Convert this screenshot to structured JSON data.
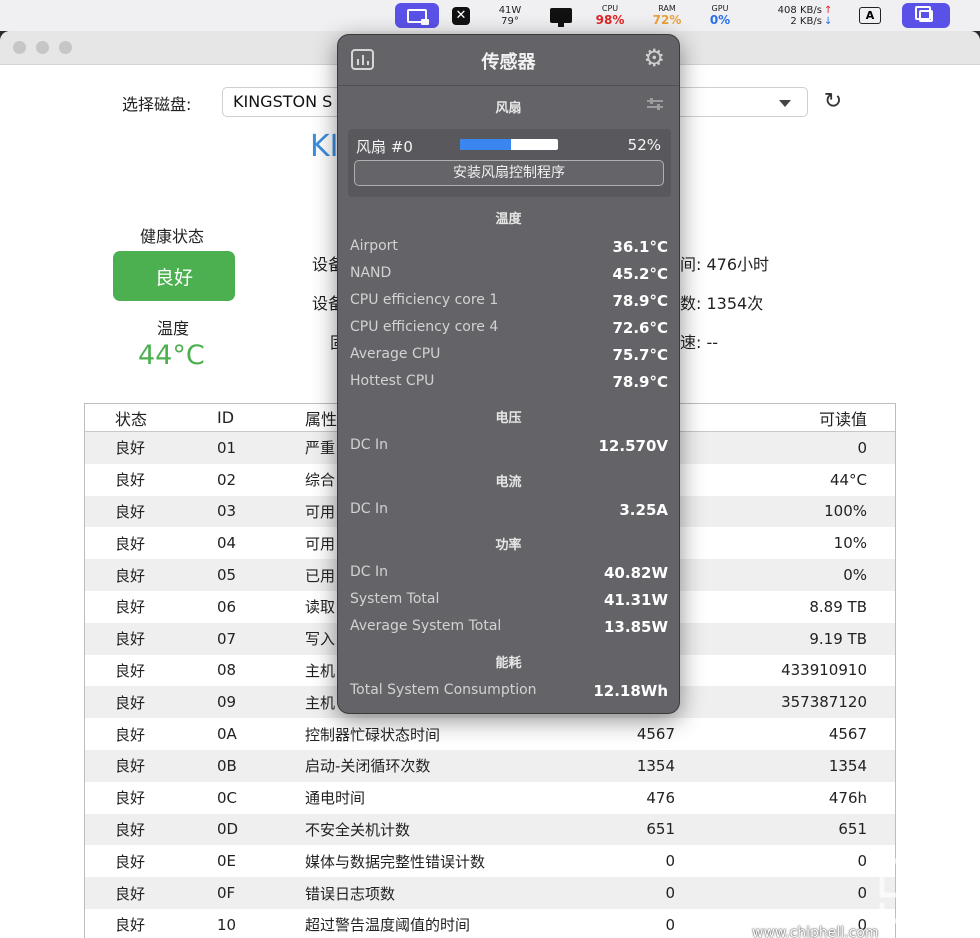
{
  "menubar": {
    "power_watts": "41W",
    "power_temp": "79°",
    "cpu": {
      "label": "CPU",
      "value": "98%",
      "color": "#e02424"
    },
    "ram": {
      "label": "RAM",
      "value": "72%",
      "color": "#e8a23a"
    },
    "gpu": {
      "label": "GPU",
      "value": "0%",
      "color": "#2a6ee8"
    },
    "net_up": "408 KB/s",
    "net_down": "2 KB/s",
    "input_method": "A"
  },
  "window": {
    "disk_label": "选择磁盘:",
    "disk_value": "KINGSTON S",
    "model_title_fragment": "KI",
    "health_label": "健康状态",
    "health_value": "良好",
    "health_color": "#4cb050",
    "temp_label": "温度",
    "temp_value": "44°C",
    "info_left": [
      "设备",
      "设备",
      "固"
    ],
    "info_right": [
      "间:  476小时",
      "数:  1354次",
      "速:  --"
    ]
  },
  "table": {
    "headers": {
      "status": "状态",
      "id": "ID",
      "attribute": "属性",
      "raw": "",
      "readable": "可读值"
    },
    "rows": [
      {
        "status": "良好",
        "id": "01",
        "attribute": "严重",
        "raw": "",
        "readable": "0"
      },
      {
        "status": "良好",
        "id": "02",
        "attribute": "综合",
        "raw": "",
        "readable": "44°C"
      },
      {
        "status": "良好",
        "id": "03",
        "attribute": "可用",
        "raw": "",
        "readable": "100%"
      },
      {
        "status": "良好",
        "id": "04",
        "attribute": "可用",
        "raw": "",
        "readable": "10%"
      },
      {
        "status": "良好",
        "id": "05",
        "attribute": "已用",
        "raw": "",
        "readable": "0%"
      },
      {
        "status": "良好",
        "id": "06",
        "attribute": "读取",
        "raw": "",
        "readable": "8.89 TB"
      },
      {
        "status": "良好",
        "id": "07",
        "attribute": "写入",
        "raw": "",
        "readable": "9.19 TB"
      },
      {
        "status": "良好",
        "id": "08",
        "attribute": "主机",
        "raw": "",
        "readable": "433910910"
      },
      {
        "status": "良好",
        "id": "09",
        "attribute": "主机",
        "raw": "",
        "readable": "357387120"
      },
      {
        "status": "良好",
        "id": "0A",
        "attribute": "控制器忙碌状态时间",
        "raw": "4567",
        "readable": "4567"
      },
      {
        "status": "良好",
        "id": "0B",
        "attribute": "启动-关闭循环次数",
        "raw": "1354",
        "readable": "1354"
      },
      {
        "status": "良好",
        "id": "0C",
        "attribute": "通电时间",
        "raw": "476",
        "readable": "476h"
      },
      {
        "status": "良好",
        "id": "0D",
        "attribute": "不安全关机计数",
        "raw": "651",
        "readable": "651"
      },
      {
        "status": "良好",
        "id": "0E",
        "attribute": "媒体与数据完整性错误计数",
        "raw": "0",
        "readable": "0"
      },
      {
        "status": "良好",
        "id": "0F",
        "attribute": "错误日志项数",
        "raw": "0",
        "readable": "0"
      },
      {
        "status": "良好",
        "id": "10",
        "attribute": "超过警告温度阈值的时间",
        "raw": "0",
        "readable": "0"
      }
    ]
  },
  "panel": {
    "title": "传感器",
    "sections": {
      "fan": "风扇",
      "temperature": "温度",
      "voltage": "电压",
      "current": "电流",
      "power": "功率",
      "energy": "能耗"
    },
    "fan": {
      "name": "风扇 #0",
      "percent_text": "52%",
      "percent": 52,
      "install_button": "安装风扇控制程序"
    },
    "temperature": [
      {
        "name": "Airport",
        "value": "36.1°C"
      },
      {
        "name": "NAND",
        "value": "45.2°C"
      },
      {
        "name": "CPU efficiency core 1",
        "value": "78.9°C"
      },
      {
        "name": "CPU efficiency core 4",
        "value": "72.6°C"
      },
      {
        "name": "Average CPU",
        "value": "75.7°C"
      },
      {
        "name": "Hottest CPU",
        "value": "78.9°C"
      }
    ],
    "voltage": [
      {
        "name": "DC In",
        "value": "12.570V"
      }
    ],
    "current": [
      {
        "name": "DC In",
        "value": "3.25A"
      }
    ],
    "power": [
      {
        "name": "DC In",
        "value": "40.82W"
      },
      {
        "name": "System Total",
        "value": "41.31W"
      },
      {
        "name": "Average System Total",
        "value": "13.85W"
      }
    ],
    "energy": [
      {
        "name": "Total System Consumption",
        "value": "12.18Wh"
      }
    ]
  },
  "watermark": {
    "url": "www.chiphell.com",
    "logo_text": "chip hell"
  }
}
